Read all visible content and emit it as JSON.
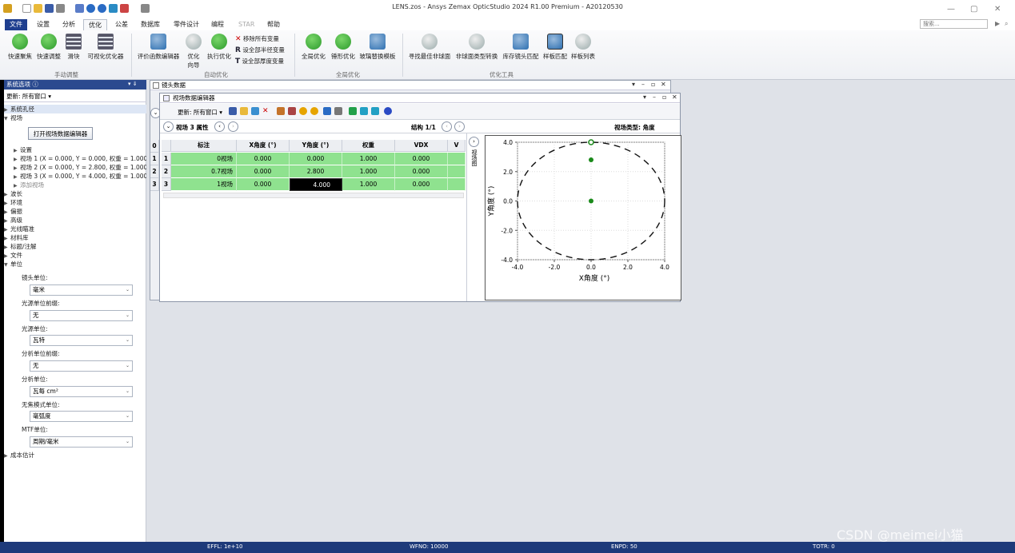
{
  "window": {
    "title": "LENS.zos - Ansys Zemax OpticStudio 2024 R1.00   Premium - A20120530"
  },
  "tabs": [
    {
      "label": "文件"
    },
    {
      "label": "设置"
    },
    {
      "label": "分析"
    },
    {
      "label": "优化"
    },
    {
      "label": "公差"
    },
    {
      "label": "数据库"
    },
    {
      "label": "零件设计"
    },
    {
      "label": "编程"
    },
    {
      "label": "STAR"
    },
    {
      "label": "帮助"
    }
  ],
  "search": {
    "placeholder": "搜索..."
  },
  "ribbon": {
    "manual": {
      "label": "手动调整",
      "buttons": [
        "快速聚焦",
        "快速调整",
        "滑块",
        "可视化优化器"
      ]
    },
    "auto": {
      "label": "自动优化",
      "buttons": [
        "评价函数编辑器",
        "优化向导",
        "执行优化"
      ],
      "small": [
        "移除所有变量",
        "设全部半径变量",
        "设全部厚度变量"
      ]
    },
    "global": {
      "label": "全局优化",
      "buttons": [
        "全局优化",
        "锤形优化",
        "玻璃替换模板"
      ]
    },
    "tools": {
      "label": "优化工具",
      "buttons": [
        "寻找最佳非球面",
        "非球面类型转换",
        "库存镜头匹配",
        "样板匹配",
        "样板列表"
      ]
    }
  },
  "left_panel": {
    "header": "系统选项 ⓘ",
    "update": "更新: 所有窗口 ▾",
    "tree": {
      "aperture": "系统孔径",
      "fields": "视场",
      "open_editor_btn": "打开视场数据编辑器",
      "settings": "设置",
      "field1": "视场 1 (X = 0.000, Y = 0.000, 权重 = 1.000)",
      "field2": "视场 2 (X = 0.000, Y = 2.800, 权重 = 1.000)",
      "field3": "视场 3 (X = 0.000, Y = 4.000, 权重 = 1.000)",
      "add_field": "添加视场",
      "wavelengths": "波长",
      "environment": "环境",
      "polarization": "偏振",
      "advanced": "高级",
      "ray_aiming": "光线瞄准",
      "material_catalogs": "材料库",
      "title_notes": "标题/注解",
      "files": "文件",
      "units": "单位",
      "cost_estimate": "成本估计"
    },
    "units": {
      "lens_units_label": "镜头单位:",
      "lens_units_value": "毫米",
      "source_prefix_label": "光源单位前缀:",
      "source_prefix_value": "无",
      "source_units_label": "光源单位:",
      "source_units_value": "瓦特",
      "analysis_prefix_label": "分析单位前缀:",
      "analysis_prefix_value": "无",
      "analysis_units_label": "分析单位:",
      "analysis_units_value": "瓦每 cm²",
      "afocal_label": "无焦模式单位:",
      "afocal_value": "毫弧度",
      "mtf_label": "MTF单位:",
      "mtf_value": "周期/毫米"
    }
  },
  "lens_window": {
    "title": "镜头数据"
  },
  "field_editor": {
    "title": "视场数据编辑器",
    "update": "更新: 所有窗口 ▾",
    "section": "视场  3 属性",
    "config": "结构 1/1",
    "field_type": "视场类型: 角度",
    "side_tab": "视场图",
    "columns": [
      "标注",
      "X角度 (°)",
      "Y角度 (°)",
      "权重",
      "VDX",
      "V"
    ],
    "rows": [
      {
        "num": "1",
        "cells": [
          "0视场",
          "0.000",
          "0.000",
          "1.000",
          "0.000"
        ]
      },
      {
        "num": "2",
        "cells": [
          "0.7视场",
          "0.000",
          "2.800",
          "1.000",
          "0.000"
        ]
      },
      {
        "num": "3",
        "cells": [
          "1视场",
          "0.000",
          "4.000",
          "1.000",
          "0.000"
        ]
      }
    ],
    "left_row_nums": [
      "0",
      "1",
      "2",
      "3"
    ]
  },
  "chart_data": {
    "type": "scatter",
    "xlabel": "X角度 (°)",
    "ylabel": "Y角度 (°)",
    "xlim": [
      -4.0,
      4.0
    ],
    "ylim": [
      -4.0,
      4.0
    ],
    "x_ticks": [
      "-4.0",
      "-2.0",
      "0.0",
      "2.0",
      "4.0"
    ],
    "y_ticks": [
      "4.0",
      "2.0",
      "0.0",
      "-2.0",
      "-4.0"
    ],
    "grid": true,
    "boundary_circle_radius": 4.0,
    "points": [
      {
        "x": 0.0,
        "y": 0.0
      },
      {
        "x": 0.0,
        "y": 2.8
      },
      {
        "x": 0.0,
        "y": 4.0
      }
    ],
    "point_color": "#1a8a1a"
  },
  "status": {
    "effl": "EFFL: 1e+10",
    "wfno": "WFNO: 10000",
    "enpd": "ENPD: 50",
    "totr": "TOTR: 0"
  },
  "watermark": "CSDN @meimei小猫",
  "colors": {
    "accent": "#1f3f8f",
    "row_green": "#8fe28f",
    "statusbar": "#1e3a7a"
  }
}
